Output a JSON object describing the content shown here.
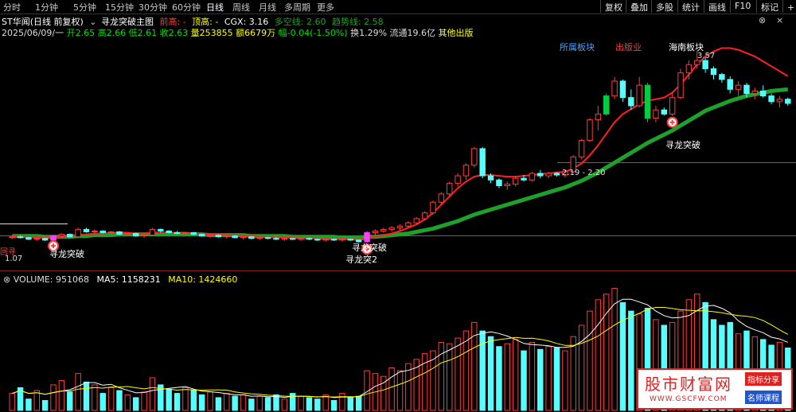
{
  "toolbar": {
    "tabs": [
      "分时",
      "1分钟",
      "5分钟",
      "15分钟",
      "30分钟",
      "60分钟",
      "日线",
      "周线",
      "月线",
      "多周期",
      "更多"
    ],
    "active_tab": "日线",
    "right_buttons": [
      "复权",
      "叠加",
      "多股",
      "统计",
      "画线",
      "F10",
      "标记",
      "+自"
    ]
  },
  "header": {
    "stock": "ST华闻(日线 前复权)",
    "indicator": "寻龙突破主图",
    "qian_gao": "前高: -",
    "ding_gao": "顶高: -",
    "cgx": "CGX: 3.16",
    "duokong": "多空线: 2.60",
    "qushi": "趋势线: 2.58"
  },
  "quote": {
    "date": "2025/06/09/一",
    "open": "开2.65",
    "high": "高2.66",
    "low": "低2.61",
    "close": "收2.63",
    "volume": "量253855",
    "amount": "额6679万",
    "change": "幅-0.04(-1.50%)",
    "turnover": "换1.29%",
    "float": "流通19.6亿",
    "other": "其他出版"
  },
  "labels": {
    "sector1": "所属板块",
    "sector2": "出版业",
    "sector3": "海南板块",
    "peak": "3.57",
    "range": "2.19 - 2.20",
    "signal": "寻龙突破",
    "signal2": "寻龙突2",
    "low_label": "1.07",
    "left_tag": "回寻"
  },
  "volume_header": {
    "volume": "VOLUME: 951068",
    "ma5": "MA5: 1158231",
    "ma10": "MA10: 1424660"
  },
  "watermark": {
    "title": "股市财富网",
    "url": "WWW.GSCFW.COM",
    "tag1": "指标分享",
    "tag2": "名师课程"
  },
  "colors": {
    "up": "#ff3c3c",
    "down": "#54ffff",
    "signal_bar": "#ff40ff",
    "ma_red": "#ff2020",
    "ma_green": "#1fa02a",
    "bright_green": "#00cc44",
    "ma5_vol": "#ffffff",
    "ma10_vol": "#ffff00"
  },
  "chart_data": {
    "type": "candlestick",
    "price_range": [
      0.95,
      3.75
    ],
    "candles": [
      [
        1.3,
        1.32,
        1.28,
        1.31
      ],
      [
        1.31,
        1.33,
        1.29,
        1.3
      ],
      [
        1.3,
        1.31,
        1.27,
        1.28
      ],
      [
        1.28,
        1.3,
        1.26,
        1.29
      ],
      [
        1.29,
        1.3,
        1.26,
        1.27
      ],
      [
        1.27,
        1.33,
        1.26,
        1.32
      ],
      [
        1.32,
        1.35,
        1.3,
        1.34
      ],
      [
        1.34,
        1.35,
        1.3,
        1.31
      ],
      [
        1.31,
        1.42,
        1.3,
        1.4
      ],
      [
        1.4,
        1.42,
        1.36,
        1.37
      ],
      [
        1.37,
        1.4,
        1.35,
        1.38
      ],
      [
        1.38,
        1.39,
        1.35,
        1.36
      ],
      [
        1.36,
        1.38,
        1.34,
        1.37
      ],
      [
        1.37,
        1.38,
        1.33,
        1.34
      ],
      [
        1.34,
        1.36,
        1.32,
        1.35
      ],
      [
        1.35,
        1.36,
        1.31,
        1.32
      ],
      [
        1.32,
        1.34,
        1.3,
        1.33
      ],
      [
        1.33,
        1.42,
        1.32,
        1.4
      ],
      [
        1.4,
        1.41,
        1.36,
        1.38
      ],
      [
        1.38,
        1.39,
        1.35,
        1.36
      ],
      [
        1.36,
        1.38,
        1.34,
        1.35
      ],
      [
        1.35,
        1.37,
        1.33,
        1.36
      ],
      [
        1.36,
        1.37,
        1.33,
        1.34
      ],
      [
        1.34,
        1.35,
        1.31,
        1.32
      ],
      [
        1.32,
        1.34,
        1.3,
        1.33
      ],
      [
        1.33,
        1.34,
        1.3,
        1.31
      ],
      [
        1.31,
        1.33,
        1.29,
        1.32
      ],
      [
        1.32,
        1.33,
        1.29,
        1.3
      ],
      [
        1.3,
        1.32,
        1.28,
        1.31
      ],
      [
        1.31,
        1.32,
        1.28,
        1.29
      ],
      [
        1.29,
        1.31,
        1.27,
        1.3
      ],
      [
        1.3,
        1.31,
        1.28,
        1.29
      ],
      [
        1.29,
        1.31,
        1.27,
        1.28
      ],
      [
        1.28,
        1.3,
        1.26,
        1.29
      ],
      [
        1.29,
        1.3,
        1.27,
        1.28
      ],
      [
        1.28,
        1.3,
        1.26,
        1.29
      ],
      [
        1.29,
        1.3,
        1.27,
        1.28
      ],
      [
        1.28,
        1.29,
        1.26,
        1.27
      ],
      [
        1.27,
        1.29,
        1.25,
        1.28
      ],
      [
        1.28,
        1.29,
        1.26,
        1.27
      ],
      [
        1.27,
        1.29,
        1.25,
        1.28
      ],
      [
        1.28,
        1.29,
        1.26,
        1.27
      ],
      [
        1.27,
        1.28,
        1.24,
        1.25
      ],
      [
        1.25,
        1.38,
        1.24,
        1.36
      ],
      [
        1.36,
        1.4,
        1.33,
        1.38
      ],
      [
        1.38,
        1.42,
        1.36,
        1.4
      ],
      [
        1.4,
        1.44,
        1.37,
        1.42
      ],
      [
        1.42,
        1.46,
        1.39,
        1.44
      ],
      [
        1.44,
        1.5,
        1.42,
        1.48
      ],
      [
        1.48,
        1.55,
        1.46,
        1.53
      ],
      [
        1.53,
        1.62,
        1.51,
        1.6
      ],
      [
        1.6,
        1.75,
        1.58,
        1.73
      ],
      [
        1.73,
        1.85,
        1.7,
        1.83
      ],
      [
        1.83,
        1.98,
        1.8,
        1.96
      ],
      [
        1.96,
        2.08,
        1.92,
        2.05
      ],
      [
        2.05,
        2.2,
        2.0,
        2.18
      ],
      [
        2.18,
        2.4,
        2.15,
        2.38
      ],
      [
        2.38,
        2.4,
        2.02,
        2.05
      ],
      [
        2.05,
        2.08,
        1.96,
        2.0
      ],
      [
        2.0,
        2.02,
        1.9,
        1.93
      ],
      [
        1.93,
        1.98,
        1.88,
        1.95
      ],
      [
        1.95,
        2.05,
        1.92,
        2.02
      ],
      [
        2.02,
        2.06,
        1.98,
        2.0
      ],
      [
        2.0,
        2.1,
        1.98,
        2.08
      ],
      [
        2.08,
        2.12,
        2.02,
        2.05
      ],
      [
        2.05,
        2.1,
        2.02,
        2.08
      ],
      [
        2.08,
        2.1,
        2.04,
        2.06
      ],
      [
        2.06,
        2.12,
        2.03,
        2.1
      ],
      [
        2.1,
        2.3,
        2.08,
        2.28
      ],
      [
        2.28,
        2.5,
        2.25,
        2.48
      ],
      [
        2.48,
        2.75,
        2.46,
        2.73
      ],
      [
        2.73,
        2.9,
        2.6,
        2.8
      ],
      [
        2.8,
        3.05,
        2.78,
        3.02
      ],
      [
        3.02,
        3.25,
        2.98,
        3.2
      ],
      [
        3.2,
        3.22,
        2.95,
        3.0
      ],
      [
        3.0,
        3.1,
        2.85,
        2.9
      ],
      [
        2.9,
        3.25,
        2.88,
        3.15
      ],
      [
        3.15,
        3.18,
        2.7,
        2.75
      ],
      [
        2.75,
        2.9,
        2.7,
        2.85
      ],
      [
        2.85,
        2.88,
        2.78,
        2.8
      ],
      [
        2.8,
        3.05,
        2.78,
        3.0
      ],
      [
        3.0,
        3.35,
        2.98,
        3.3
      ],
      [
        3.3,
        3.45,
        3.22,
        3.4
      ],
      [
        3.4,
        3.57,
        3.35,
        3.45
      ],
      [
        3.45,
        3.48,
        3.3,
        3.35
      ],
      [
        3.35,
        3.38,
        3.22,
        3.28
      ],
      [
        3.28,
        3.3,
        3.18,
        3.22
      ],
      [
        3.22,
        3.26,
        3.05,
        3.1
      ],
      [
        3.1,
        3.2,
        3.02,
        3.15
      ],
      [
        3.15,
        3.18,
        3.0,
        3.05
      ],
      [
        3.05,
        3.12,
        2.98,
        3.08
      ],
      [
        3.08,
        3.15,
        3.0,
        3.02
      ],
      [
        3.02,
        3.05,
        2.92,
        2.95
      ],
      [
        2.95,
        3.02,
        2.88,
        2.98
      ],
      [
        2.98,
        3.0,
        2.9,
        2.93
      ]
    ],
    "volume": [
      120,
      160,
      80,
      140,
      70,
      180,
      210,
      130,
      260,
      200,
      180,
      120,
      160,
      140,
      110,
      90,
      130,
      230,
      180,
      150,
      120,
      160,
      140,
      110,
      130,
      90,
      120,
      100,
      110,
      80,
      100,
      90,
      110,
      80,
      120,
      100,
      90,
      80,
      110,
      70,
      120,
      90,
      100,
      280,
      260,
      240,
      300,
      280,
      330,
      360,
      400,
      420,
      480,
      470,
      510,
      560,
      620,
      560,
      520,
      450,
      470,
      500,
      420,
      480,
      430,
      450,
      440,
      420,
      520,
      600,
      700,
      780,
      820,
      860,
      760,
      700,
      680,
      720,
      640,
      600,
      620,
      700,
      780,
      820,
      760,
      640,
      600,
      620,
      540,
      560,
      520,
      500,
      460,
      480,
      440
    ],
    "signal_indices": [
      5,
      43
    ],
    "ma_red": [
      1.32,
      1.31,
      1.31,
      1.3,
      1.3,
      1.3,
      1.31,
      1.32,
      1.33,
      1.34,
      1.35,
      1.35,
      1.36,
      1.36,
      1.36,
      1.35,
      1.35,
      1.36,
      1.36,
      1.36,
      1.36,
      1.36,
      1.35,
      1.35,
      1.34,
      1.34,
      1.33,
      1.33,
      1.32,
      1.32,
      1.31,
      1.31,
      1.3,
      1.3,
      1.3,
      1.29,
      1.29,
      1.29,
      1.28,
      1.28,
      1.28,
      1.28,
      1.27,
      1.29,
      1.31,
      1.33,
      1.35,
      1.38,
      1.42,
      1.46,
      1.52,
      1.6,
      1.7,
      1.8,
      1.9,
      1.98,
      2.04,
      2.06,
      2.06,
      2.05,
      2.04,
      2.04,
      2.05,
      2.06,
      2.07,
      2.08,
      2.09,
      2.1,
      2.14,
      2.2,
      2.3,
      2.42,
      2.56,
      2.7,
      2.8,
      2.86,
      2.92,
      2.96,
      2.98,
      3.0,
      3.06,
      3.16,
      3.28,
      3.4,
      3.5,
      3.56,
      3.6,
      3.6,
      3.58,
      3.54,
      3.5,
      3.44,
      3.38,
      3.32,
      3.26
    ],
    "ma_green": [
      1.32,
      1.32,
      1.32,
      1.32,
      1.31,
      1.31,
      1.31,
      1.31,
      1.32,
      1.32,
      1.33,
      1.33,
      1.33,
      1.34,
      1.34,
      1.34,
      1.34,
      1.34,
      1.34,
      1.34,
      1.34,
      1.34,
      1.34,
      1.34,
      1.33,
      1.33,
      1.33,
      1.33,
      1.33,
      1.32,
      1.32,
      1.32,
      1.32,
      1.32,
      1.31,
      1.31,
      1.31,
      1.31,
      1.31,
      1.31,
      1.3,
      1.3,
      1.3,
      1.31,
      1.31,
      1.32,
      1.33,
      1.34,
      1.35,
      1.37,
      1.39,
      1.41,
      1.44,
      1.47,
      1.5,
      1.54,
      1.58,
      1.61,
      1.64,
      1.67,
      1.7,
      1.73,
      1.76,
      1.79,
      1.82,
      1.85,
      1.88,
      1.91,
      1.95,
      1.99,
      2.04,
      2.09,
      2.15,
      2.21,
      2.27,
      2.33,
      2.39,
      2.45,
      2.5,
      2.55,
      2.6,
      2.66,
      2.72,
      2.78,
      2.84,
      2.88,
      2.92,
      2.96,
      2.99,
      3.02,
      3.04,
      3.06,
      3.08,
      3.09,
      3.1
    ]
  }
}
